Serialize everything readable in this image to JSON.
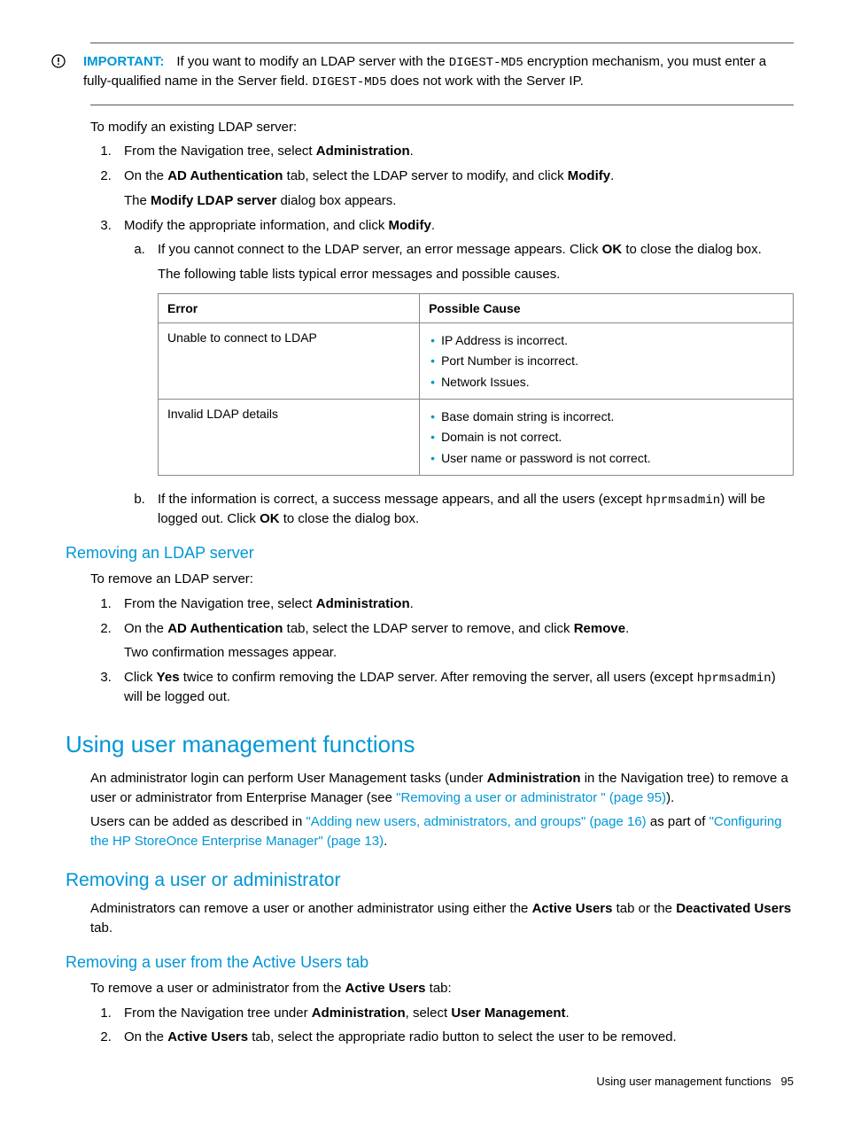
{
  "callout": {
    "label": "IMPORTANT:",
    "text_before_code1": "If you want to modify an LDAP server with the ",
    "code1": "DIGEST-MD5",
    "text_mid": " encryption mechanism, you must enter a fully-qualified name in the Server field. ",
    "code2": "DIGEST-MD5",
    "text_after": " does not work with the Server IP."
  },
  "modify": {
    "intro": "To modify an existing LDAP server:",
    "step1_a": "From the Navigation tree, select ",
    "step1_b": "Administration",
    "step1_c": ".",
    "step2_a": "On the ",
    "step2_b": "AD Authentication",
    "step2_c": " tab, select the LDAP server to modify, and click ",
    "step2_d": "Modify",
    "step2_e": ".",
    "step2_sub_a": "The ",
    "step2_sub_b": "Modify LDAP server",
    "step2_sub_c": " dialog box appears.",
    "step3_a": "Modify the appropriate information, and click ",
    "step3_b": "Modify",
    "step3_c": ".",
    "step3a_a": "If you cannot connect to the LDAP server, an error message appears. Click ",
    "step3a_b": "OK",
    "step3a_c": " to close the dialog box.",
    "step3a_sub": "The following table lists typical error messages and possible causes.",
    "step3b_a": "If the information is correct, a success message appears, and all the users (except ",
    "step3b_code": "hprmsadmin",
    "step3b_b": ") will be logged out. Click ",
    "step3b_c": "OK",
    "step3b_d": " to close the dialog box."
  },
  "table": {
    "h1": "Error",
    "h2": "Possible Cause",
    "r1c1": "Unable to connect to LDAP",
    "r1c2": [
      "IP Address is incorrect.",
      "Port Number is incorrect.",
      "Network Issues."
    ],
    "r2c1": "Invalid LDAP details",
    "r2c2": [
      "Base domain string is incorrect.",
      "Domain is not correct.",
      "User name or password is not correct."
    ]
  },
  "removing_ldap": {
    "heading": "Removing an LDAP server",
    "intro": "To remove an LDAP server:",
    "s1a": "From the Navigation tree, select ",
    "s1b": "Administration",
    "s1c": ".",
    "s2a": "On the ",
    "s2b": "AD Authentication",
    "s2c": " tab, select the LDAP server to remove, and click ",
    "s2d": "Remove",
    "s2e": ".",
    "s2sub": "Two confirmation messages appear.",
    "s3a": "Click ",
    "s3b": "Yes",
    "s3c": " twice to confirm removing the LDAP server. After removing the server, all users (except ",
    "s3code": "hprmsadmin",
    "s3d": ") will be logged out."
  },
  "usermgmt": {
    "heading": "Using user management functions",
    "p1a": "An administrator login can perform User Management tasks (under ",
    "p1b": "Administration",
    "p1c": " in the Navigation tree) to remove a user or administrator from Enterprise Manager (see ",
    "p1link": "\"Removing a user or administrator \" (page 95)",
    "p1d": ").",
    "p2a": "Users can be added as described in ",
    "p2link1": "\"Adding new users, administrators, and groups\" (page 16)",
    "p2b": " as part of ",
    "p2link2": "\"Configuring the HP StoreOnce Enterprise Manager\" (page 13)",
    "p2c": "."
  },
  "removeuser": {
    "heading": "Removing a user or administrator",
    "pa": "Administrators can remove a user or another administrator using either the ",
    "pb": "Active Users",
    "pc": " tab or the ",
    "pd": "Deactivated Users",
    "pe": " tab."
  },
  "removeactive": {
    "heading": "Removing a user from the Active Users tab",
    "intro_a": "To remove a user or administrator from the ",
    "intro_b": "Active Users",
    "intro_c": " tab:",
    "s1a": "From the Navigation tree under ",
    "s1b": "Administration",
    "s1c": ", select ",
    "s1d": "User Management",
    "s1e": ".",
    "s2a": "On the ",
    "s2b": "Active Users",
    "s2c": " tab, select the appropriate radio button to select the user to be removed."
  },
  "footer": {
    "text": "Using user management functions",
    "page": "95"
  }
}
